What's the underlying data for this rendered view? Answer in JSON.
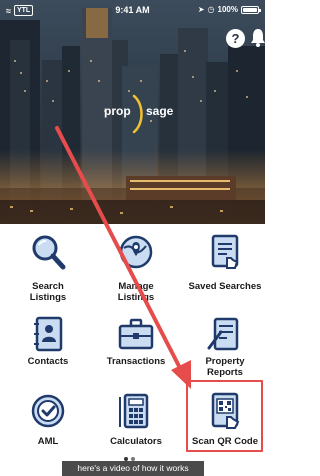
{
  "status_bar": {
    "carrier": "YTL",
    "time": "9:41 AM",
    "battery_percent_label": "100%",
    "battery_level": 1.0
  },
  "header": {
    "help_label": "?",
    "logo_word_1": "prop",
    "logo_word_2": "sage"
  },
  "menu": {
    "search_listings": "Search\nListings",
    "manage_listings": "Manage\nListings",
    "saved_searches": "Saved Searches",
    "contacts": "Contacts",
    "transactions": "Transactions",
    "property_reports": "Property\nReports",
    "aml": "AML",
    "calculators": "Calculators",
    "scan_qr_code": "Scan QR Code"
  },
  "banner": {
    "text": "here's a video of how it works"
  },
  "colors": {
    "icon_navy": "#1f3a6b",
    "icon_light_blue": "#c9dcf2",
    "highlight_red": "#e74c4c"
  }
}
